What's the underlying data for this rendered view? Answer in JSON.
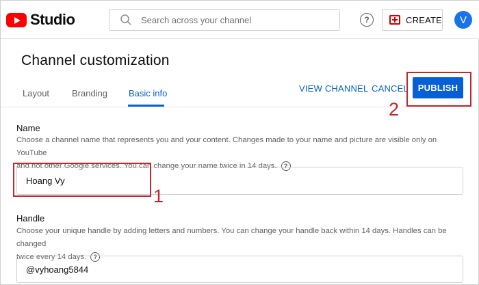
{
  "app": {
    "logo_text": "Studio",
    "search_placeholder": "Search across your channel",
    "help_symbol": "?",
    "create_label": "CREATE",
    "avatar_letter": "V"
  },
  "page": {
    "title": "Channel customization",
    "tabs": [
      {
        "label": "Layout",
        "active": false
      },
      {
        "label": "Branding",
        "active": false
      },
      {
        "label": "Basic info",
        "active": true
      }
    ],
    "view_channel_label": "VIEW CHANNEL",
    "cancel_label": "CANCEL",
    "publish_label": "PUBLISH"
  },
  "name_section": {
    "title": "Name",
    "desc_line1": "Choose a channel name that represents you and your content. Changes made to your name and picture are visible only on YouTube",
    "desc_line2": "and not other Google services. You can change your name twice in 14 days.",
    "help_symbol": "?",
    "value": "Hoang Vy"
  },
  "handle_section": {
    "title": "Handle",
    "desc_line1": "Choose your unique handle by adding letters and numbers. You can change your handle back within 14 days. Handles can be changed",
    "desc_line2": "twice every 14 days.",
    "help_symbol": "?",
    "value": "@vyhoang5844"
  },
  "annotations": {
    "marker_1": "1",
    "marker_2": "2",
    "color": "#c0282e"
  },
  "colors": {
    "accent": "#065fd4",
    "brand_red": "#ff0000"
  },
  "icons": [
    "youtube-play-icon",
    "search-icon",
    "help-icon",
    "create-video-icon"
  ]
}
